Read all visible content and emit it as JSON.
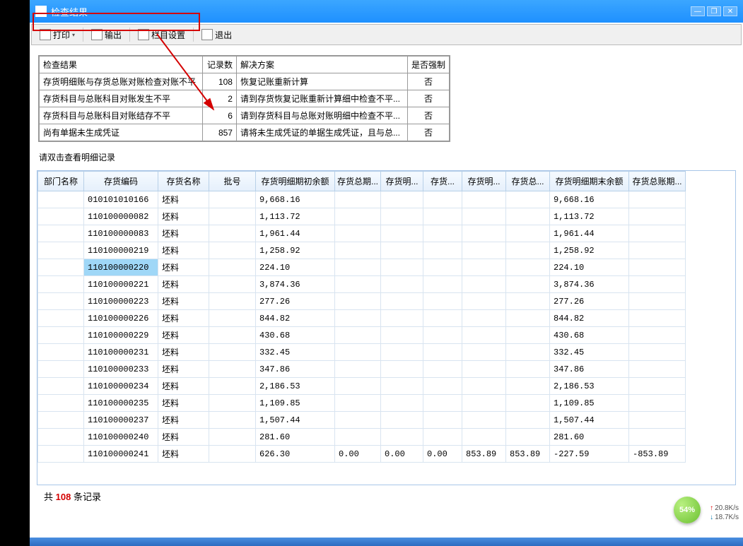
{
  "window": {
    "title": "检查结果"
  },
  "toolbar": {
    "print": "打印",
    "export": "输出",
    "columns": "栏目设置",
    "exit": "退出"
  },
  "upper": {
    "headers": {
      "result": "检查结果",
      "count": "记录数",
      "solution": "解决方案",
      "force": "是否强制"
    },
    "rows": [
      {
        "result": "存货明细账与存货总账对账检查对账不平",
        "count": "108",
        "solution": "恢复记账重新计算",
        "force": "否"
      },
      {
        "result": "存货科目与总账科目对账发生不平",
        "count": "2",
        "solution": "请到存货恢复记账重新计算细中检查不平...",
        "force": "否"
      },
      {
        "result": "存货科目与总账科目对账结存不平",
        "count": "6",
        "solution": "请到存货科目与总账对账明细中检查不平...",
        "force": "否"
      },
      {
        "result": "尚有单据未生成凭证",
        "count": "857",
        "solution": "请将未生成凭证的单据生成凭证，且与总...",
        "force": "否"
      }
    ]
  },
  "instruction": "请双击查看明细记录",
  "detail": {
    "headers": {
      "dept": "部门名称",
      "code": "存货编码",
      "name": "存货名称",
      "batch": "批号",
      "c5": "存货明细期初余额",
      "c6": "存货总期...",
      "c7": "存货明...",
      "c8": "存货...",
      "c9": "存货明...",
      "c10": "存货总...",
      "c11": "存货明细期末余额",
      "c12": "存货总账期..."
    },
    "rows": [
      {
        "code": "010101010166",
        "name": "坯料",
        "c5": "9,668.16",
        "c11": "9,668.16"
      },
      {
        "code": "110100000082",
        "name": "坯料",
        "c5": "1,113.72",
        "c11": "1,113.72"
      },
      {
        "code": "110100000083",
        "name": "坯料",
        "c5": "1,961.44",
        "c11": "1,961.44"
      },
      {
        "code": "110100000219",
        "name": "坯料",
        "c5": "1,258.92",
        "c11": "1,258.92"
      },
      {
        "code": "110100000220",
        "name": "坯料",
        "c5": "224.10",
        "c11": "224.10",
        "selected": true
      },
      {
        "code": "110100000221",
        "name": "坯料",
        "c5": "3,874.36",
        "c11": "3,874.36"
      },
      {
        "code": "110100000223",
        "name": "坯料",
        "c5": "277.26",
        "c11": "277.26"
      },
      {
        "code": "110100000226",
        "name": "坯料",
        "c5": "844.82",
        "c11": "844.82"
      },
      {
        "code": "110100000229",
        "name": "坯料",
        "c5": "430.68",
        "c11": "430.68"
      },
      {
        "code": "110100000231",
        "name": "坯料",
        "c5": "332.45",
        "c11": "332.45"
      },
      {
        "code": "110100000233",
        "name": "坯料",
        "c5": "347.86",
        "c11": "347.86"
      },
      {
        "code": "110100000234",
        "name": "坯料",
        "c5": "2,186.53",
        "c11": "2,186.53"
      },
      {
        "code": "110100000235",
        "name": "坯料",
        "c5": "1,109.85",
        "c11": "1,109.85"
      },
      {
        "code": "110100000237",
        "name": "坯料",
        "c5": "1,507.44",
        "c11": "1,507.44"
      },
      {
        "code": "110100000240",
        "name": "坯料",
        "c5": "281.60",
        "c11": "281.60"
      },
      {
        "code": "110100000241",
        "name": "坯料",
        "c5": "626.30",
        "c6": "0.00",
        "c7": "0.00",
        "c8": "0.00",
        "c9": "853.89",
        "c10": "853.89",
        "c11": "-227.59",
        "c12": "-853.89"
      }
    ]
  },
  "summary": {
    "prefix": "共",
    "count": "108",
    "suffix": "条记录"
  },
  "badge": "54%",
  "net": {
    "up": "20.8K/s",
    "down": "18.7K/s"
  }
}
